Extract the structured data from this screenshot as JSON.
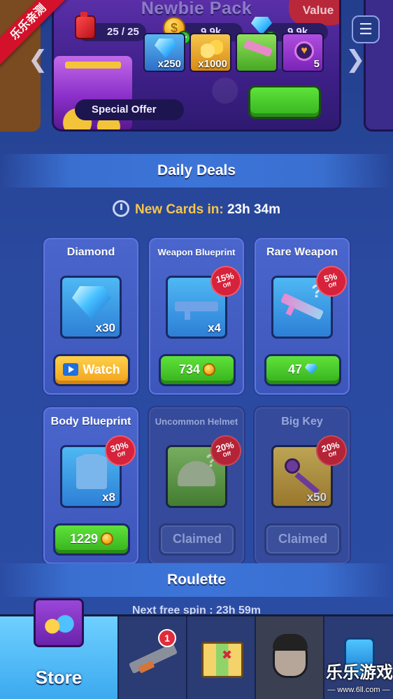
{
  "corner_ribbon": "乐乐亲测",
  "banner": {
    "title": "Newbie Pack",
    "value_badge": "Value",
    "resources": {
      "fuel": "25 / 25",
      "coins": "9,9k",
      "gems": "9,9k"
    },
    "coin_symbol": "$",
    "rewards": [
      {
        "icon": "gem-icon",
        "qty": "x250"
      },
      {
        "icon": "coins-icon",
        "qty": "x1000"
      },
      {
        "icon": "gun-blueprint-icon",
        "qty": ""
      },
      {
        "icon": "heart-token-icon",
        "qty": "5"
      }
    ],
    "special_offer_label": "Special Offer",
    "arrow_left": "❮",
    "arrow_right": "❯",
    "menu_icon": "☰"
  },
  "daily_deals": {
    "title": "Daily Deals",
    "timer_label": "New Cards in:",
    "timer_value": "23h 34m",
    "cards": [
      {
        "title": "Diamond",
        "qty": "x30",
        "discount": "",
        "button": "Watch",
        "state": "watch"
      },
      {
        "title": "Weapon Blueprint",
        "qty": "x4",
        "discount": "15%",
        "button": "734",
        "state": "buy-coins"
      },
      {
        "title": "Rare Weapon",
        "qty": "",
        "discount": "5%",
        "button": "47",
        "state": "buy-gems"
      },
      {
        "title": "Body Blueprint",
        "qty": "x8",
        "discount": "30%",
        "button": "1229",
        "state": "buy-coins"
      },
      {
        "title": "Uncommon Helmet",
        "qty": "",
        "discount": "20%",
        "button": "Claimed",
        "state": "claimed"
      },
      {
        "title": "Big Key",
        "qty": "x50",
        "discount": "20%",
        "button": "Claimed",
        "state": "claimed"
      }
    ],
    "off_label": "Off",
    "question_mark": "?"
  },
  "roulette": {
    "title": "Roulette",
    "next_spin": "Next free spin : 23h 59m"
  },
  "bottom_nav": {
    "store": "Store",
    "weapons_badge": "1"
  },
  "watermark": {
    "brand": "乐乐游戏",
    "url": "— www.6ll.com —"
  },
  "colors": {
    "background": "#23408f",
    "accent_gold": "#f6c64a",
    "buy_green": "#35b01d",
    "watch_orange": "#f1a21a",
    "discount_red": "#d6223a"
  }
}
